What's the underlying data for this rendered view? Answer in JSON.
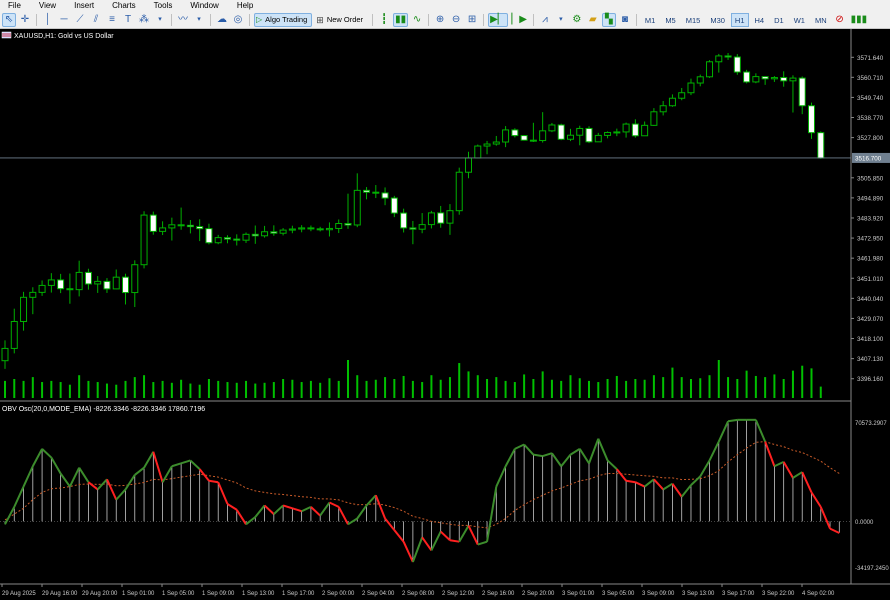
{
  "menu": [
    "File",
    "View",
    "Insert",
    "Charts",
    "Tools",
    "Window",
    "Help"
  ],
  "toolbar": {
    "algo_trading": "Algo Trading",
    "new_order": "New Order",
    "timeframes": [
      "M1",
      "M5",
      "M15",
      "M30",
      "H1",
      "H4",
      "D1",
      "W1",
      "MN"
    ],
    "active_timeframe": "H1",
    "icons": [
      "cursor-icon",
      "crosshair-icon",
      "vertical-line-icon",
      "horizontal-line-icon",
      "trendline-icon",
      "channel-icon",
      "fibonacci-icon",
      "text-icon",
      "shapes-icon",
      "indicators-icon",
      "market-icon",
      "signals-icon",
      "play-icon",
      "order-icon",
      "bar-chart-icon",
      "candle-chart-icon",
      "line-chart-icon",
      "zoom-in-icon",
      "zoom-out-icon",
      "grid-icon",
      "autoscroll-icon",
      "chart-shift-icon",
      "indicator-list-icon",
      "settings-icon",
      "folder-icon",
      "color-icon",
      "screenshot-icon",
      "alert-icon",
      "signal-strength-icon"
    ]
  },
  "chart": {
    "symbol_title": "XAUUSD,H1: Gold vs US Dollar",
    "flag_icon": "us-flag-icon",
    "current_price": "3516.700",
    "price_labels": [
      "3571.640",
      "3560.710",
      "3549.740",
      "3538.770",
      "3527.800",
      "3505.850",
      "3494.890",
      "3483.920",
      "3472.950",
      "3461.980",
      "3451.010",
      "3440.040",
      "3429.070",
      "3418.100",
      "3407.130",
      "3396.160"
    ],
    "time_labels": [
      "29 Aug 2025",
      "29 Aug 16:00",
      "29 Aug 20:00",
      "1 Sep 01:00",
      "1 Sep 05:00",
      "1 Sep 09:00",
      "1 Sep 13:00",
      "1 Sep 17:00",
      "2 Sep 00:00",
      "2 Sep 04:00",
      "2 Sep 08:00",
      "2 Sep 12:00",
      "2 Sep 16:00",
      "2 Sep 20:00",
      "3 Sep 01:00",
      "3 Sep 05:00",
      "3 Sep 09:00",
      "3 Sep 13:00",
      "3 Sep 17:00",
      "3 Sep 22:00",
      "4 Sep 02:00"
    ],
    "indicator_title": "OBV Osc(20,0,MODE_EMA) -8226.3346 -8226.3346 17860.7196",
    "indicator_labels": [
      "70573.2907",
      "0.0000",
      "-34197.2450"
    ],
    "colors": {
      "up": "#00b000",
      "down_body": "#ffffff",
      "up_body": "#000000",
      "volume": "#00c000",
      "obv_up": "#3c8c2c",
      "obv_down": "#ff2020",
      "signal": "#c85a28",
      "hist": "#c8c8c8"
    }
  },
  "chart_data": {
    "type": "candlestick",
    "price_candles": [
      {
        "o": 3406.0,
        "h": 3417.1,
        "l": 3401.5,
        "c": 3412.7
      },
      {
        "o": 3412.7,
        "h": 3434.4,
        "l": 3410.0,
        "c": 3427.4
      },
      {
        "o": 3427.4,
        "h": 3443.6,
        "l": 3422.4,
        "c": 3440.6
      },
      {
        "o": 3440.6,
        "h": 3446.1,
        "l": 3431.4,
        "c": 3443.3
      },
      {
        "o": 3443.3,
        "h": 3449.8,
        "l": 3441.4,
        "c": 3447.1
      },
      {
        "o": 3447.1,
        "h": 3453.8,
        "l": 3443.2,
        "c": 3450.1
      },
      {
        "o": 3450.1,
        "h": 3453.4,
        "l": 3442.9,
        "c": 3445.3
      },
      {
        "o": 3445.3,
        "h": 3453.6,
        "l": 3437.1,
        "c": 3444.8
      },
      {
        "o": 3444.8,
        "h": 3460.6,
        "l": 3441.1,
        "c": 3454.2
      },
      {
        "o": 3454.2,
        "h": 3456.2,
        "l": 3444.8,
        "c": 3447.9
      },
      {
        "o": 3447.9,
        "h": 3452.2,
        "l": 3443.0,
        "c": 3449.3
      },
      {
        "o": 3449.3,
        "h": 3451.1,
        "l": 3443.0,
        "c": 3445.2
      },
      {
        "o": 3445.2,
        "h": 3455.8,
        "l": 3445.0,
        "c": 3451.6
      },
      {
        "o": 3451.6,
        "h": 3453.5,
        "l": 3436.7,
        "c": 3443.2
      },
      {
        "o": 3443.2,
        "h": 3460.8,
        "l": 3435.3,
        "c": 3458.4
      },
      {
        "o": 3458.4,
        "h": 3487.6,
        "l": 3456.4,
        "c": 3485.5
      },
      {
        "o": 3485.5,
        "h": 3487.4,
        "l": 3474.8,
        "c": 3476.6
      },
      {
        "o": 3476.6,
        "h": 3482.1,
        "l": 3474.6,
        "c": 3478.5
      },
      {
        "o": 3478.5,
        "h": 3484.1,
        "l": 3471.6,
        "c": 3480.2
      },
      {
        "o": 3480.2,
        "h": 3489.6,
        "l": 3477.5,
        "c": 3479.9
      },
      {
        "o": 3479.9,
        "h": 3482.8,
        "l": 3475.5,
        "c": 3479.2
      },
      {
        "o": 3479.2,
        "h": 3483.2,
        "l": 3471.3,
        "c": 3478.1
      },
      {
        "o": 3478.1,
        "h": 3480.8,
        "l": 3469.5,
        "c": 3470.4
      },
      {
        "o": 3470.4,
        "h": 3474.7,
        "l": 3469.6,
        "c": 3473.2
      },
      {
        "o": 3473.2,
        "h": 3474.5,
        "l": 3470.1,
        "c": 3472.4
      },
      {
        "o": 3472.4,
        "h": 3475.0,
        "l": 3468.9,
        "c": 3471.8
      },
      {
        "o": 3471.8,
        "h": 3476.0,
        "l": 3470.3,
        "c": 3475.0
      },
      {
        "o": 3475.0,
        "h": 3479.8,
        "l": 3469.8,
        "c": 3474.2
      },
      {
        "o": 3474.2,
        "h": 3479.6,
        "l": 3473.2,
        "c": 3476.4
      },
      {
        "o": 3476.4,
        "h": 3479.9,
        "l": 3474.2,
        "c": 3475.6
      },
      {
        "o": 3475.6,
        "h": 3478.4,
        "l": 3474.4,
        "c": 3477.3
      },
      {
        "o": 3477.3,
        "h": 3479.7,
        "l": 3475.6,
        "c": 3477.9
      },
      {
        "o": 3477.9,
        "h": 3480.0,
        "l": 3476.1,
        "c": 3478.5
      },
      {
        "o": 3478.5,
        "h": 3479.8,
        "l": 3476.7,
        "c": 3478.0
      },
      {
        "o": 3478.0,
        "h": 3479.1,
        "l": 3476.6,
        "c": 3477.5
      },
      {
        "o": 3477.5,
        "h": 3481.5,
        "l": 3473.8,
        "c": 3478.2
      },
      {
        "o": 3478.2,
        "h": 3483.1,
        "l": 3475.7,
        "c": 3480.9
      },
      {
        "o": 3480.9,
        "h": 3497.2,
        "l": 3478.0,
        "c": 3480.1
      },
      {
        "o": 3480.1,
        "h": 3508.3,
        "l": 3478.9,
        "c": 3499.0
      },
      {
        "o": 3499.0,
        "h": 3500.8,
        "l": 3494.1,
        "c": 3498.0
      },
      {
        "o": 3498.0,
        "h": 3501.9,
        "l": 3494.8,
        "c": 3497.6
      },
      {
        "o": 3497.6,
        "h": 3500.6,
        "l": 3490.9,
        "c": 3494.8
      },
      {
        "o": 3494.8,
        "h": 3496.0,
        "l": 3484.4,
        "c": 3486.6
      },
      {
        "o": 3486.6,
        "h": 3489.0,
        "l": 3476.0,
        "c": 3478.5
      },
      {
        "o": 3478.5,
        "h": 3482.3,
        "l": 3469.6,
        "c": 3477.8
      },
      {
        "o": 3477.8,
        "h": 3486.6,
        "l": 3475.6,
        "c": 3480.3
      },
      {
        "o": 3480.3,
        "h": 3487.8,
        "l": 3478.2,
        "c": 3486.7
      },
      {
        "o": 3486.7,
        "h": 3490.5,
        "l": 3478.6,
        "c": 3481.1
      },
      {
        "o": 3481.1,
        "h": 3491.5,
        "l": 3474.7,
        "c": 3487.9
      },
      {
        "o": 3487.9,
        "h": 3511.4,
        "l": 3485.7,
        "c": 3508.9
      },
      {
        "o": 3508.9,
        "h": 3520.1,
        "l": 3505.6,
        "c": 3516.7
      },
      {
        "o": 3516.7,
        "h": 3524.0,
        "l": 3516.7,
        "c": 3523.2
      },
      {
        "o": 3523.2,
        "h": 3526.0,
        "l": 3518.7,
        "c": 3524.3
      },
      {
        "o": 3524.3,
        "h": 3528.7,
        "l": 3523.4,
        "c": 3525.4
      },
      {
        "o": 3525.4,
        "h": 3534.1,
        "l": 3522.6,
        "c": 3532.0
      },
      {
        "o": 3532.0,
        "h": 3532.9,
        "l": 3527.9,
        "c": 3528.9
      },
      {
        "o": 3528.9,
        "h": 3529.2,
        "l": 3526.2,
        "c": 3526.4
      },
      {
        "o": 3526.4,
        "h": 3535.9,
        "l": 3525.4,
        "c": 3526.2
      },
      {
        "o": 3526.2,
        "h": 3541.7,
        "l": 3525.1,
        "c": 3531.5
      },
      {
        "o": 3531.5,
        "h": 3535.8,
        "l": 3530.8,
        "c": 3534.7
      },
      {
        "o": 3534.7,
        "h": 3535.4,
        "l": 3526.4,
        "c": 3526.9
      },
      {
        "o": 3526.9,
        "h": 3532.6,
        "l": 3525.9,
        "c": 3529.1
      },
      {
        "o": 3529.1,
        "h": 3534.3,
        "l": 3523.6,
        "c": 3532.8
      },
      {
        "o": 3532.8,
        "h": 3534.0,
        "l": 3524.8,
        "c": 3525.5
      },
      {
        "o": 3525.5,
        "h": 3530.4,
        "l": 3525.4,
        "c": 3529.0
      },
      {
        "o": 3529.0,
        "h": 3531.2,
        "l": 3527.4,
        "c": 3530.6
      },
      {
        "o": 3530.6,
        "h": 3532.7,
        "l": 3528.6,
        "c": 3530.9
      },
      {
        "o": 3530.9,
        "h": 3536.0,
        "l": 3527.8,
        "c": 3535.2
      },
      {
        "o": 3535.2,
        "h": 3537.8,
        "l": 3527.8,
        "c": 3528.8
      },
      {
        "o": 3528.8,
        "h": 3536.6,
        "l": 3528.7,
        "c": 3534.5
      },
      {
        "o": 3534.5,
        "h": 3543.9,
        "l": 3534.2,
        "c": 3541.9
      },
      {
        "o": 3541.9,
        "h": 3547.8,
        "l": 3539.9,
        "c": 3545.2
      },
      {
        "o": 3545.2,
        "h": 3551.4,
        "l": 3544.6,
        "c": 3549.3
      },
      {
        "o": 3549.3,
        "h": 3554.9,
        "l": 3548.2,
        "c": 3552.3
      },
      {
        "o": 3552.3,
        "h": 3560.0,
        "l": 3551.0,
        "c": 3557.6
      },
      {
        "o": 3557.6,
        "h": 3562.2,
        "l": 3555.8,
        "c": 3561.0
      },
      {
        "o": 3561.0,
        "h": 3570.1,
        "l": 3560.4,
        "c": 3569.2
      },
      {
        "o": 3569.2,
        "h": 3573.5,
        "l": 3563.3,
        "c": 3572.4
      },
      {
        "o": 3572.4,
        "h": 3574.0,
        "l": 3570.2,
        "c": 3571.8
      },
      {
        "o": 3571.8,
        "h": 3573.4,
        "l": 3562.1,
        "c": 3563.6
      },
      {
        "o": 3563.6,
        "h": 3564.8,
        "l": 3557.4,
        "c": 3558.2
      },
      {
        "o": 3558.2,
        "h": 3562.9,
        "l": 3557.5,
        "c": 3561.1
      },
      {
        "o": 3561.1,
        "h": 3561.2,
        "l": 3556.6,
        "c": 3559.9
      },
      {
        "o": 3559.9,
        "h": 3561.4,
        "l": 3558.2,
        "c": 3560.6
      },
      {
        "o": 3560.6,
        "h": 3564.0,
        "l": 3555.6,
        "c": 3558.8
      },
      {
        "o": 3558.8,
        "h": 3561.8,
        "l": 3541.5,
        "c": 3560.3
      },
      {
        "o": 3560.3,
        "h": 3561.2,
        "l": 3540.6,
        "c": 3545.2
      },
      {
        "o": 3545.2,
        "h": 3546.9,
        "l": 3527.1,
        "c": 3530.5
      },
      {
        "o": 3530.5,
        "h": 3531.2,
        "l": 3516.2,
        "c": 3516.7
      }
    ],
    "volume_scale": [
      0.45,
      0.5,
      0.45,
      0.55,
      0.42,
      0.45,
      0.42,
      0.35,
      0.6,
      0.45,
      0.42,
      0.38,
      0.35,
      0.45,
      0.55,
      0.6,
      0.42,
      0.45,
      0.4,
      0.48,
      0.38,
      0.35,
      0.5,
      0.45,
      0.42,
      0.4,
      0.45,
      0.38,
      0.4,
      0.42,
      0.5,
      0.48,
      0.42,
      0.45,
      0.4,
      0.52,
      0.45,
      1.0,
      0.6,
      0.45,
      0.48,
      0.55,
      0.5,
      0.58,
      0.45,
      0.42,
      0.6,
      0.48,
      0.55,
      0.92,
      0.7,
      0.6,
      0.5,
      0.55,
      0.45,
      0.42,
      0.62,
      0.5,
      0.7,
      0.48,
      0.45,
      0.6,
      0.52,
      0.45,
      0.42,
      0.5,
      0.58,
      0.45,
      0.5,
      0.48,
      0.6,
      0.55,
      0.8,
      0.55,
      0.5,
      0.52,
      0.6,
      1.0,
      0.55,
      0.5,
      0.72,
      0.58,
      0.55,
      0.62,
      0.5,
      0.72,
      0.85,
      0.78,
      0.3
    ],
    "obv_osc": [
      -2000,
      10000,
      24000,
      38000,
      50000,
      44000,
      33000,
      24000,
      37000,
      27000,
      22000,
      29000,
      15000,
      22000,
      32000,
      37000,
      48000,
      27000,
      38000,
      40000,
      42000,
      36000,
      28000,
      27000,
      12000,
      8000,
      -2000,
      3000,
      11000,
      5000,
      11000,
      9000,
      7000,
      10000,
      4000,
      13000,
      10000,
      -2000,
      2000,
      11000,
      18000,
      2000,
      -6000,
      -14000,
      -28000,
      -11000,
      -20000,
      -7000,
      -13000,
      -14000,
      -3000,
      -16000,
      -14000,
      24000,
      38000,
      50000,
      53000,
      46000,
      45000,
      47000,
      38000,
      46000,
      50000,
      40000,
      57000,
      42000,
      36000,
      28000,
      27000,
      24000,
      29000,
      22000,
      26000,
      17000,
      25000,
      31000,
      42000,
      55000,
      69000,
      70000,
      70000,
      70000,
      55000,
      38000,
      41000,
      30000,
      34000,
      20000,
      10000,
      -5000,
      -8000
    ],
    "obv_signal": [
      1000,
      5000,
      9000,
      15000,
      20000,
      22500,
      23000,
      24000,
      25500,
      25800,
      25500,
      25800,
      24500,
      24800,
      25800,
      26800,
      29000,
      28500,
      29500,
      30500,
      31500,
      32500,
      31500,
      30500,
      28500,
      26500,
      23000,
      21000,
      20000,
      19000,
      18500,
      17800,
      17000,
      16500,
      15500,
      15500,
      14800,
      12800,
      11500,
      11600,
      12200,
      11200,
      9500,
      7000,
      3500,
      2000,
      0,
      -1000,
      -2000,
      -2800,
      -2800,
      -3800,
      -4500,
      -2000,
      2000,
      7500,
      11500,
      15000,
      18000,
      21000,
      23000,
      25500,
      28000,
      29000,
      31500,
      33000,
      33000,
      32500,
      32000,
      31500,
      31000,
      30000,
      30000,
      28800,
      29000,
      29500,
      31500,
      35000,
      41000,
      46000,
      50500,
      54500,
      55000,
      53000,
      51500,
      49000,
      47500,
      44500,
      41500,
      37000,
      33000
    ],
    "price_range": [
      3390,
      3580
    ],
    "obv_range": [
      -34197.245,
      70573.2907
    ]
  }
}
